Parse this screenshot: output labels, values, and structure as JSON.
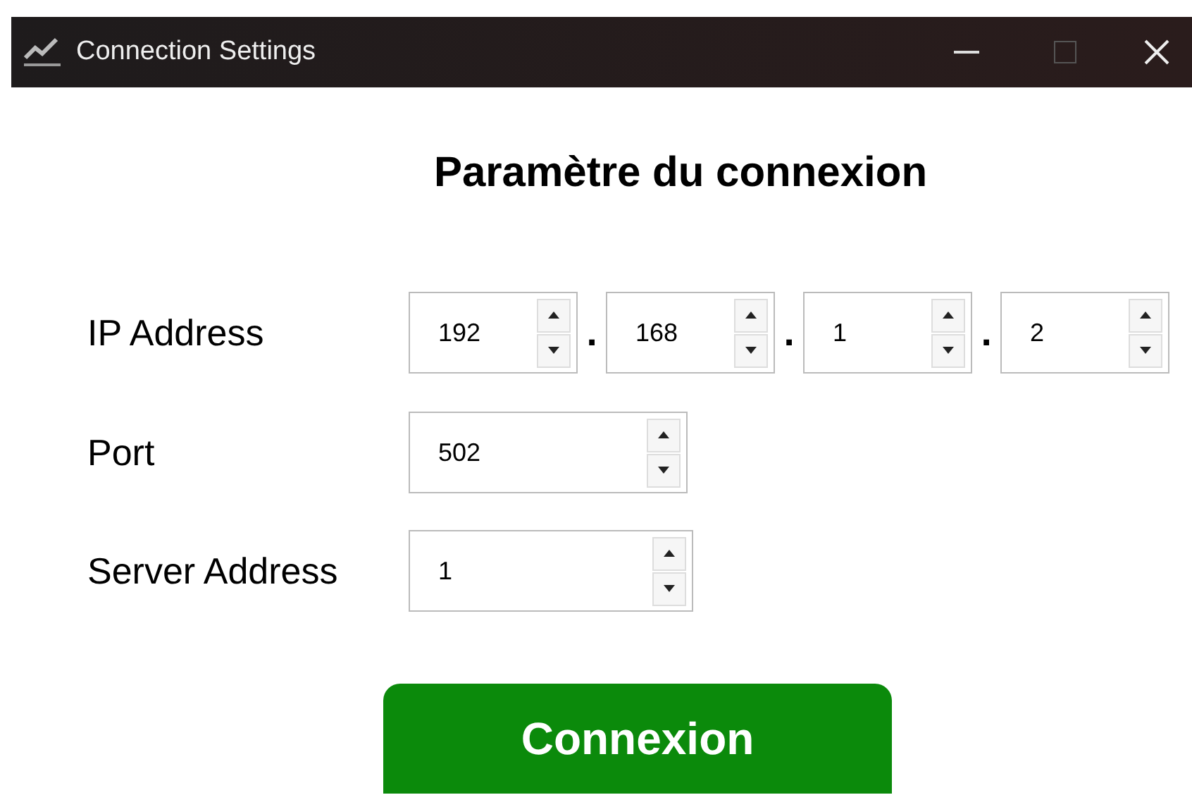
{
  "window": {
    "title": "Connection Settings",
    "maximize_disabled": true
  },
  "heading": "Paramètre du connexion",
  "ip_address": {
    "label": "IP Address",
    "octets": [
      {
        "value": "192",
        "separator": "."
      },
      {
        "value": "168",
        "separator": "."
      },
      {
        "value": "1",
        "separator": "."
      },
      {
        "value": "2"
      }
    ]
  },
  "port": {
    "label": "Port",
    "value": "502"
  },
  "server_address": {
    "label": "Server Address",
    "value": "1"
  },
  "connect_button": "Connexion"
}
